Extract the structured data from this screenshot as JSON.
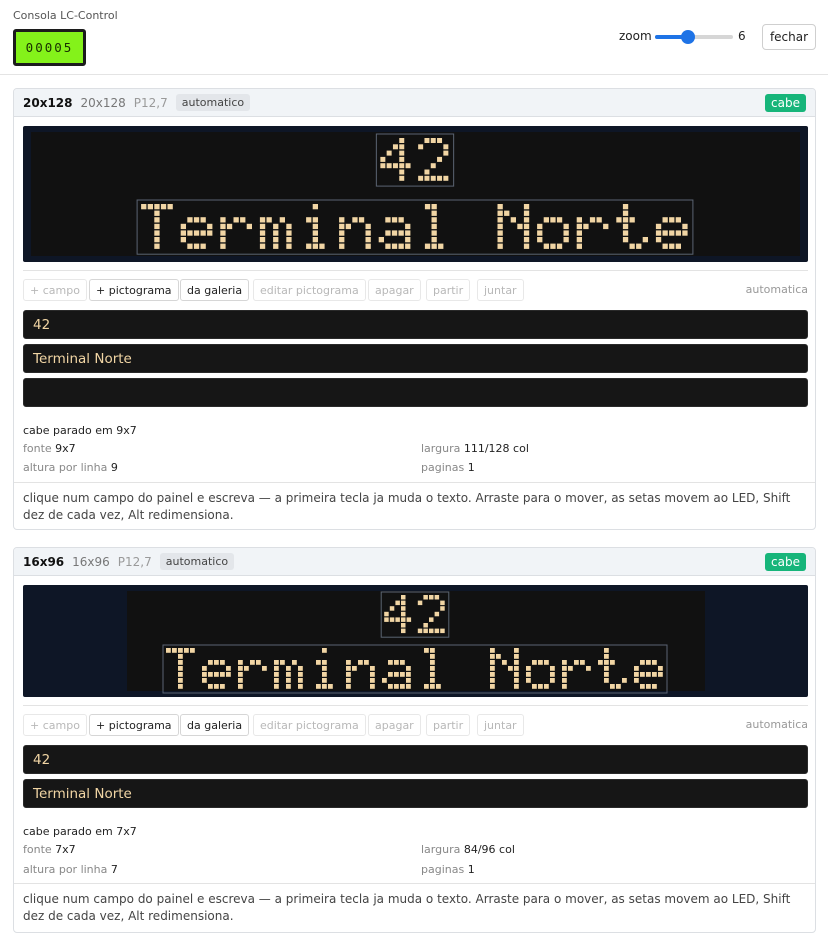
{
  "app": {
    "title": "Consola LC-Control",
    "counter": "00005",
    "zoom_label": "zoom",
    "zoom_value": "6",
    "zoom_fraction": 0.42,
    "close_label": "fechar"
  },
  "colors": {
    "accent": "#1e73e6",
    "fit_badge": "#17b57a",
    "counter_bg": "#84f21a",
    "led_on": "#f1d5a4",
    "led_bg": "#0e1626"
  },
  "panels": [
    {
      "name": "20x128",
      "size": "20x128",
      "pitch": "P12,7",
      "mode": "automatico",
      "fit": "cabe",
      "route": "42",
      "destination": "Terminal Norte",
      "toolbar": {
        "add_field": "+ campo",
        "add_pictogram": "+ pictograma",
        "from_gallery": "da galeria",
        "edit_pictogram": "editar pictograma",
        "delete": "apagar",
        "split": "partir",
        "join": "juntar",
        "mode": "automatica"
      },
      "fields": [
        "42",
        "Terminal Norte",
        ""
      ],
      "status": "cabe parado em 9x7",
      "font_label": "fonte",
      "font_value": "9x7",
      "width_label": "largura",
      "width_value": "111/128 col",
      "line_height_label": "altura por linha",
      "line_height_value": "9",
      "pages_label": "paginas",
      "pages_value": "1",
      "hint": "clique num campo do painel e escreva — a primeira tecla ja muda o texto. Arraste para o mover, as setas movem ao LED, Shift dez de cada vez, Alt redimensiona."
    },
    {
      "name": "16x96",
      "size": "16x96",
      "pitch": "P12,7",
      "mode": "automatico",
      "fit": "cabe",
      "route": "42",
      "destination": "Terminal Norte",
      "toolbar": {
        "add_field": "+ campo",
        "add_pictogram": "+ pictograma",
        "from_gallery": "da galeria",
        "edit_pictogram": "editar pictograma",
        "delete": "apagar",
        "split": "partir",
        "join": "juntar",
        "mode": "automatica"
      },
      "fields": [
        "42",
        "Terminal Norte"
      ],
      "status": "cabe parado em 7x7",
      "font_label": "fonte",
      "font_value": "7x7",
      "width_label": "largura",
      "width_value": "84/96 col",
      "line_height_label": "altura por linha",
      "line_height_value": "7",
      "pages_label": "paginas",
      "pages_value": "1",
      "hint": "clique num campo do painel e escreva — a primeira tecla ja muda o texto. Arraste para o mover, as setas movem ao LED, Shift dez de cada vez, Alt redimensiona."
    }
  ]
}
